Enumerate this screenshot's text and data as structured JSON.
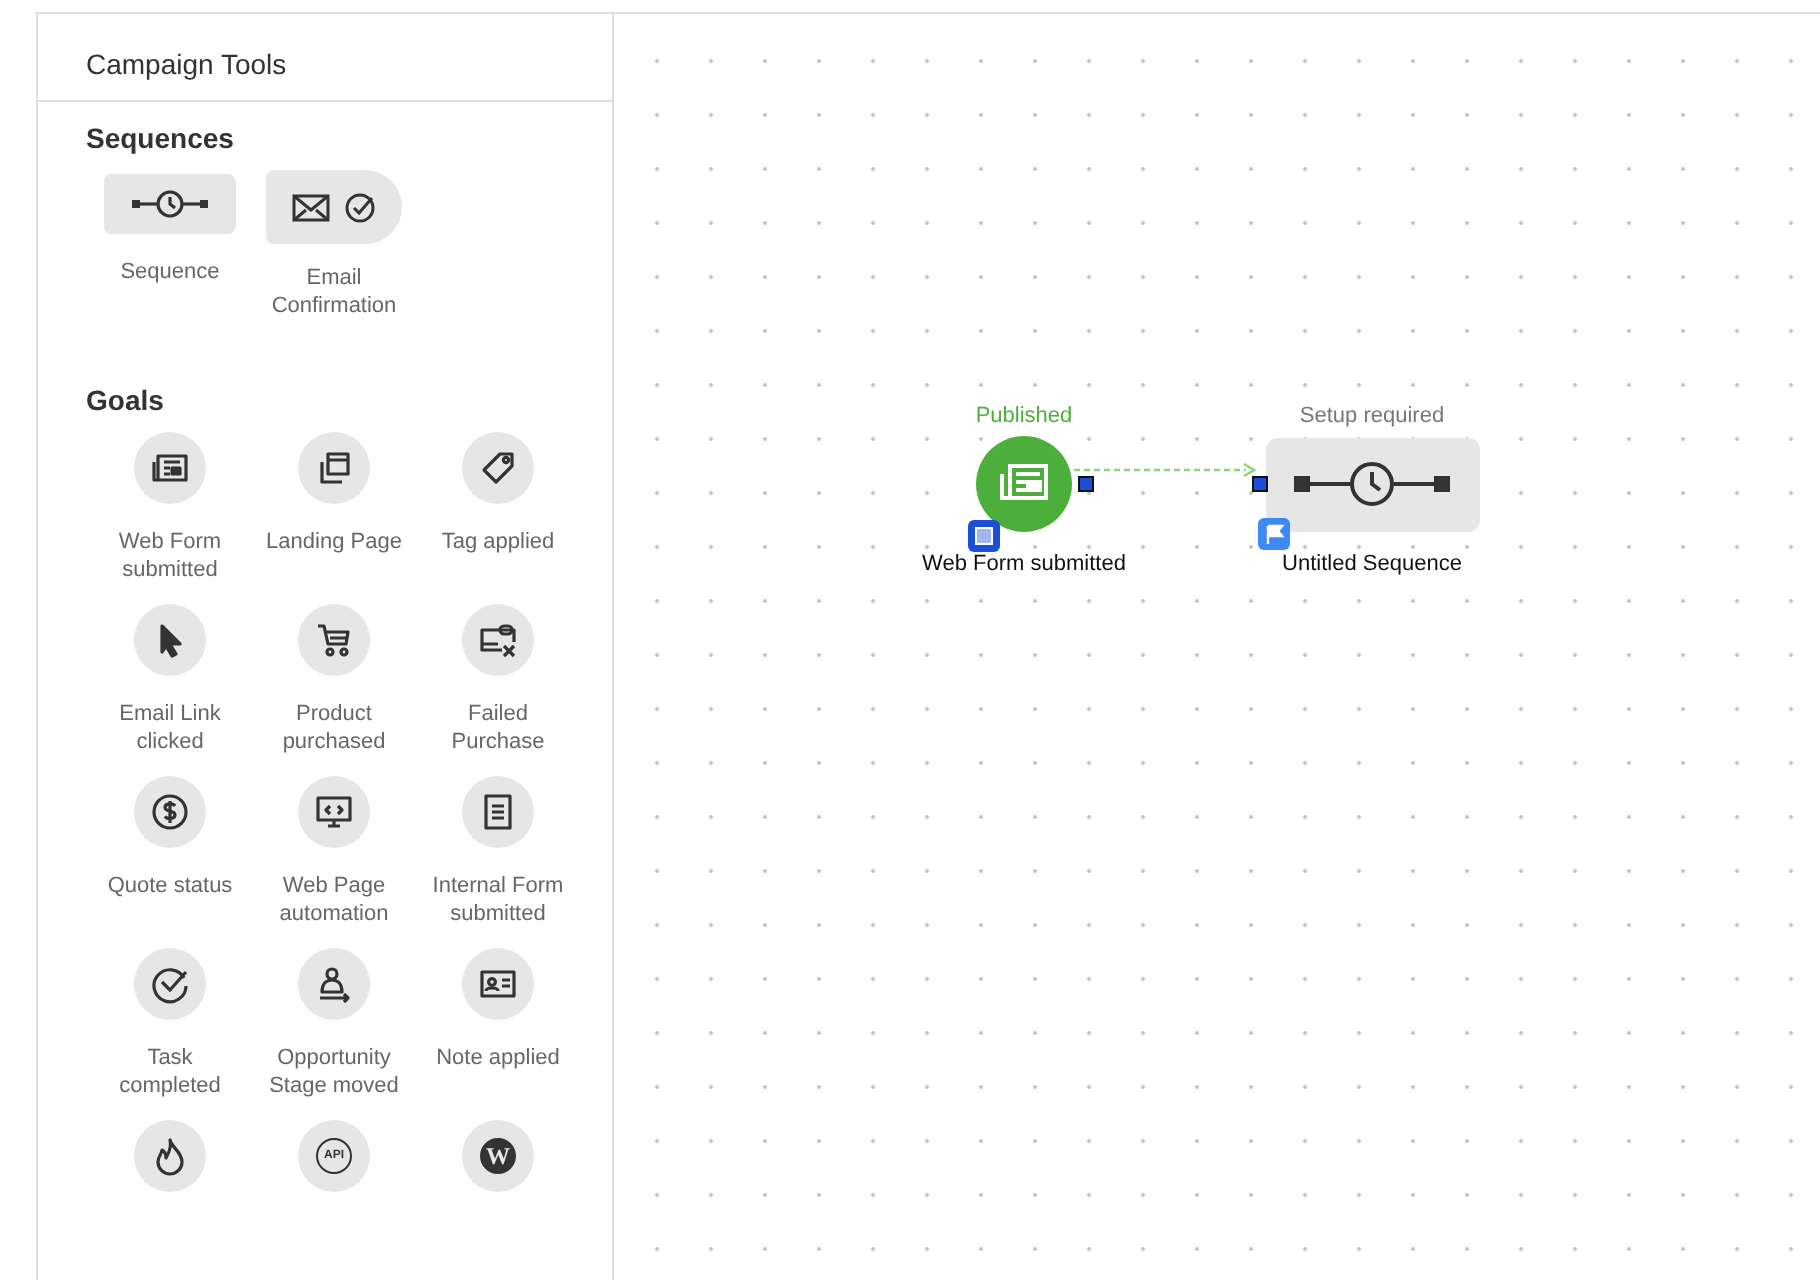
{
  "panel": {
    "title": "Campaign Tools",
    "sections": [
      {
        "heading": "Sequences",
        "items": [
          {
            "kind": "sequence",
            "label": "Sequence"
          },
          {
            "kind": "email-confirmation",
            "label": "Email Confirmation"
          }
        ]
      },
      {
        "heading": "Goals",
        "items": [
          {
            "kind": "form",
            "label": "Web Form submitted"
          },
          {
            "kind": "landing",
            "label": "Landing Page"
          },
          {
            "kind": "tag",
            "label": "Tag applied"
          },
          {
            "kind": "cursor",
            "label": "Email Link clicked"
          },
          {
            "kind": "cart",
            "label": "Product purchased"
          },
          {
            "kind": "failed",
            "label": "Failed Purchase"
          },
          {
            "kind": "dollar",
            "label": "Quote status"
          },
          {
            "kind": "code",
            "label": "Web Page automation"
          },
          {
            "kind": "doc",
            "label": "Internal Form submitted"
          },
          {
            "kind": "check",
            "label": "Task completed"
          },
          {
            "kind": "person",
            "label": "Opportunity Stage moved"
          },
          {
            "kind": "note",
            "label": "Note applied"
          },
          {
            "kind": "flame"
          },
          {
            "kind": "api",
            "icon_text": "API"
          },
          {
            "kind": "wordpress",
            "icon_text": "W"
          }
        ]
      }
    ]
  },
  "canvas": {
    "nodes": [
      {
        "kind": "goal",
        "status": "Published",
        "color": "#4caf3c",
        "label": "Web Form submitted"
      },
      {
        "kind": "sequence",
        "status": "Setup required",
        "color": "#777777",
        "label": "Untitled Sequence"
      }
    ]
  }
}
